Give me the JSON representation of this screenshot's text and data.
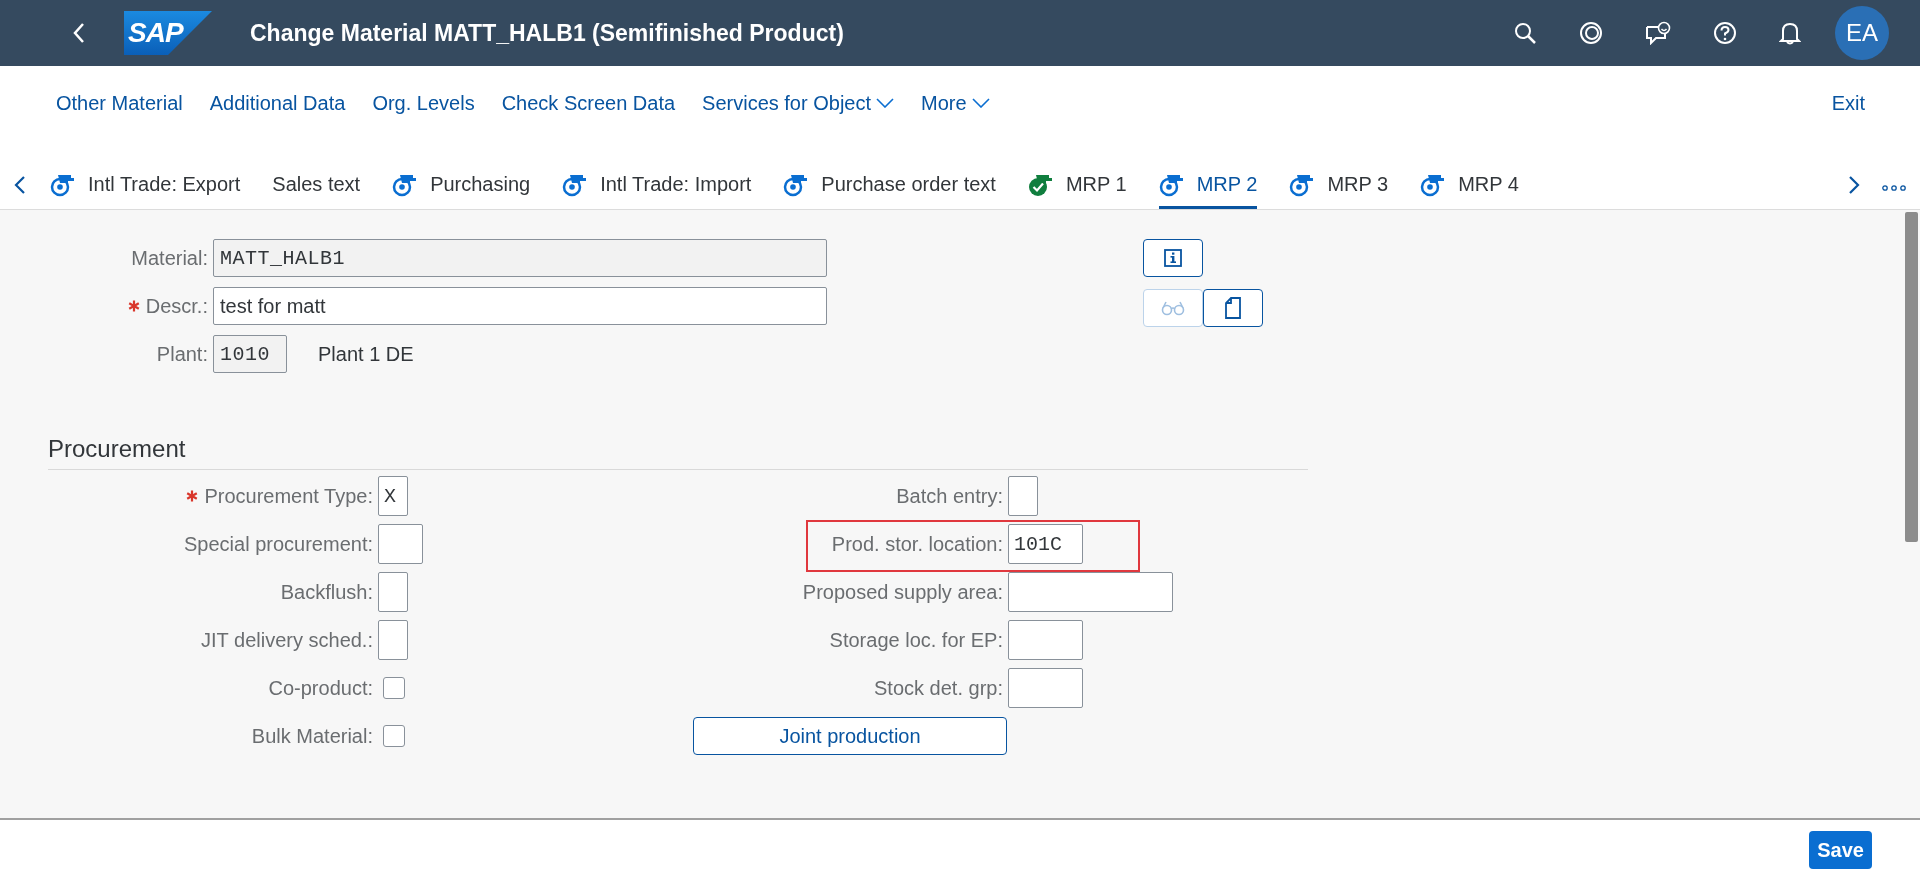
{
  "shell": {
    "title": "Change Material MATT_HALB1 (Semifinished Product)",
    "logo": "SAP",
    "avatar": "EA"
  },
  "toolbar": {
    "links": [
      {
        "label": "Other Material",
        "menu": false
      },
      {
        "label": "Additional Data",
        "menu": false
      },
      {
        "label": "Org. Levels",
        "menu": false
      },
      {
        "label": "Check Screen Data",
        "menu": false
      },
      {
        "label": "Services for Object",
        "menu": true
      },
      {
        "label": "More",
        "menu": true
      }
    ],
    "exit": "Exit"
  },
  "tabs": [
    {
      "label": "Intl Trade: Export",
      "selected": false,
      "kind": "open"
    },
    {
      "label": "Sales text",
      "selected": false,
      "kind": "plain"
    },
    {
      "label": "Purchasing",
      "selected": false,
      "kind": "open"
    },
    {
      "label": "Intl Trade: Import",
      "selected": false,
      "kind": "open"
    },
    {
      "label": "Purchase order text",
      "selected": false,
      "kind": "open"
    },
    {
      "label": "MRP 1",
      "selected": false,
      "kind": "done"
    },
    {
      "label": "MRP 2",
      "selected": true,
      "kind": "open"
    },
    {
      "label": "MRP 3",
      "selected": false,
      "kind": "open"
    },
    {
      "label": "MRP 4",
      "selected": false,
      "kind": "open"
    }
  ],
  "header_fields": [
    {
      "label": "Material:",
      "required": false,
      "kind": "readonly",
      "value": "MATT_HALB1"
    },
    {
      "label": "Descr.:",
      "required": true,
      "kind": "input",
      "value": "test for matt"
    },
    {
      "label": "Plant:",
      "required": false,
      "kind": "readonly",
      "value": "1010",
      "description": "Plant 1 DE"
    }
  ],
  "header_buttons": [
    {
      "kind": "info",
      "disabled": false
    },
    {
      "kind": "glasses",
      "disabled": true
    },
    {
      "kind": "document",
      "disabled": false
    }
  ],
  "procurement": {
    "title": "Procurement",
    "left": [
      {
        "label": "Procurement Type:",
        "required": true,
        "kind": "input",
        "value": "X"
      },
      {
        "label": "Special procurement:",
        "required": false,
        "kind": "input"
      },
      {
        "label": "Backflush:",
        "required": false,
        "kind": "input"
      },
      {
        "label": "JIT delivery sched.:",
        "required": false,
        "kind": "input"
      },
      {
        "label": "Co-product:",
        "required": false,
        "kind": "checkbox",
        "checked": false
      },
      {
        "label": "Bulk Material:",
        "required": false,
        "kind": "checkbox",
        "checked": false
      }
    ],
    "right": [
      {
        "label": "Batch entry:",
        "kind": "input",
        "highlighted": false
      },
      {
        "label": "Prod. stor. location:",
        "kind": "input",
        "value": "101C",
        "highlighted": true
      },
      {
        "label": "Proposed supply area:",
        "kind": "input",
        "highlighted": false
      },
      {
        "label": "Storage loc. for EP:",
        "kind": "input",
        "highlighted": false
      },
      {
        "label": "Stock det. grp:",
        "kind": "input",
        "highlighted": false
      },
      {
        "label": "Joint production",
        "kind": "button",
        "highlighted": false
      }
    ]
  },
  "footer": {
    "save": "Save"
  }
}
